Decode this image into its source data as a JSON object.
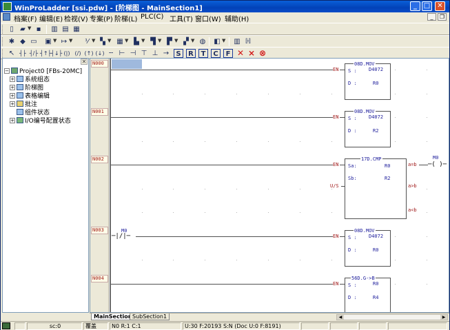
{
  "window": {
    "title": "WinProLadder [ssi.pdw] - [阶梯图 - MainSection1]"
  },
  "menu": {
    "items": [
      "档案(F)",
      "编辑(E)",
      "检视(V)",
      "专案(P)",
      "阶梯(L)",
      "PLC(C)",
      "工具(T)",
      "窗口(W)",
      "辅助(H)"
    ]
  },
  "toolbar1": {
    "buttons": [
      {
        "name": "new-file",
        "glyph": "▯"
      },
      {
        "name": "open-folder",
        "glyph": "▰"
      },
      {
        "name": "save",
        "glyph": "▪"
      },
      {
        "name": "ladder-view",
        "glyph": "▥"
      },
      {
        "name": "table-view",
        "glyph": "▤"
      },
      {
        "name": "code-view",
        "glyph": "▦"
      }
    ]
  },
  "toolbar2": {
    "buttons": [
      "✱",
      "◆",
      "▭",
      "▣",
      "↦",
      "⅟",
      "▚",
      "▦",
      "▙",
      "▜",
      "▛",
      "▞",
      "◍",
      "◧",
      "▥",
      "ℍ"
    ]
  },
  "toolbar3": {
    "buttons": [
      "↖",
      "┤├",
      "┤/├",
      "┤↑├",
      "┤↓├",
      "(|)",
      "(/)",
      "(↑)",
      "(↓)",
      "╌",
      "⊢",
      "⊣",
      "⊤",
      "⊥",
      "→",
      "S",
      "R",
      "T",
      "C",
      "F",
      "✕",
      "⨯",
      "⊗"
    ],
    "colored": {
      "red": "#d21a1a",
      "blue": "#1a3a9a"
    }
  },
  "tree": {
    "root": "Project0 [FBs-20MC]",
    "items": [
      "系统组态",
      "阶梯图",
      "表格编辑",
      "批注",
      "组件状态",
      "I/O编号配置状态"
    ]
  },
  "ladder": {
    "rows": [
      "N000",
      "N001",
      "N002",
      "N003",
      "N004"
    ],
    "blocks": [
      {
        "title": "08D.MOV",
        "lines": [
          {
            "pin": "S :",
            "val": "D4072"
          },
          {
            "pin": "D :",
            "val": "R0"
          }
        ]
      },
      {
        "title": "08D.MOV",
        "lines": [
          {
            "pin": "S :",
            "val": "D4072"
          },
          {
            "pin": "D :",
            "val": "R2"
          }
        ]
      },
      {
        "title": "17D.CMP",
        "lines": [
          {
            "pin": "Sa:",
            "val": "R0"
          },
          {
            "pin": "Sb:",
            "val": "R2"
          }
        ],
        "outputs": [
          "a=b",
          "a>b",
          "a<b"
        ],
        "extra_input": "U/S"
      },
      {
        "title": "08D.MOV",
        "lines": [
          {
            "pin": "S :",
            "val": "D4072"
          },
          {
            "pin": "D :",
            "val": "R0"
          }
        ]
      },
      {
        "title": "56D.G->B",
        "lines": [
          {
            "pin": "S :",
            "val": "R0"
          },
          {
            "pin": "D :",
            "val": "R4"
          }
        ]
      }
    ],
    "en_label": "EN",
    "contact_label": "M0",
    "contact_symbol": "─|/|─",
    "coil_label": "M0",
    "coil_symbol": "─( )─"
  },
  "tabs": [
    "MainSection1",
    "SubSection1"
  ],
  "status": {
    "sc": "sc:0",
    "mode": "覆盖",
    "pos": "N0 R:1 C:1",
    "mem": "U:30 F:20193 S:N (Doc U:0 F:8191)"
  }
}
